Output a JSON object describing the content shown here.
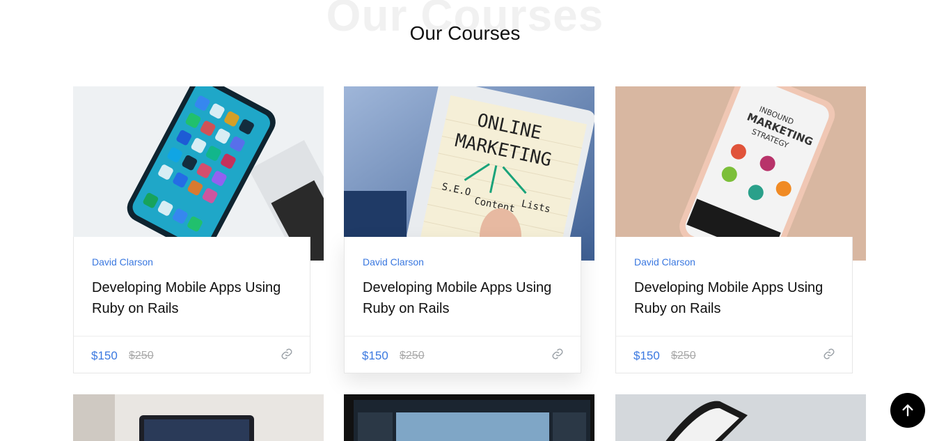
{
  "section": {
    "bg_title": "Our Courses",
    "title": "Our Courses"
  },
  "courses": [
    {
      "author": "David Clarson",
      "title": "Developing Mobile Apps Using Ruby on Rails",
      "price": "$150",
      "old_price": "$250",
      "image": "phone-with-apps"
    },
    {
      "author": "David Clarson",
      "title": "Developing Mobile Apps Using Ruby on Rails",
      "price": "$150",
      "old_price": "$250",
      "image": "online-marketing-tablet"
    },
    {
      "author": "David Clarson",
      "title": "Developing Mobile Apps Using Ruby on Rails",
      "price": "$150",
      "old_price": "$250",
      "image": "inbound-marketing-phone"
    }
  ],
  "image_text": {
    "tablet_line1": "ONLINE",
    "tablet_line2": "MARKETING",
    "tablet_seo": "S.E.O",
    "tablet_content": "Content",
    "tablet_lists": "Lists",
    "phone_line1": "INBOUND",
    "phone_line2": "MARKETING",
    "phone_line3": "STRATEGY"
  },
  "colors": {
    "accent": "#3a78e0",
    "title": "#111111",
    "muted": "#a9a9a9",
    "back_to_top": "#000000"
  },
  "icons": {
    "link": "link-icon",
    "back_to_top": "arrow-up-icon"
  }
}
